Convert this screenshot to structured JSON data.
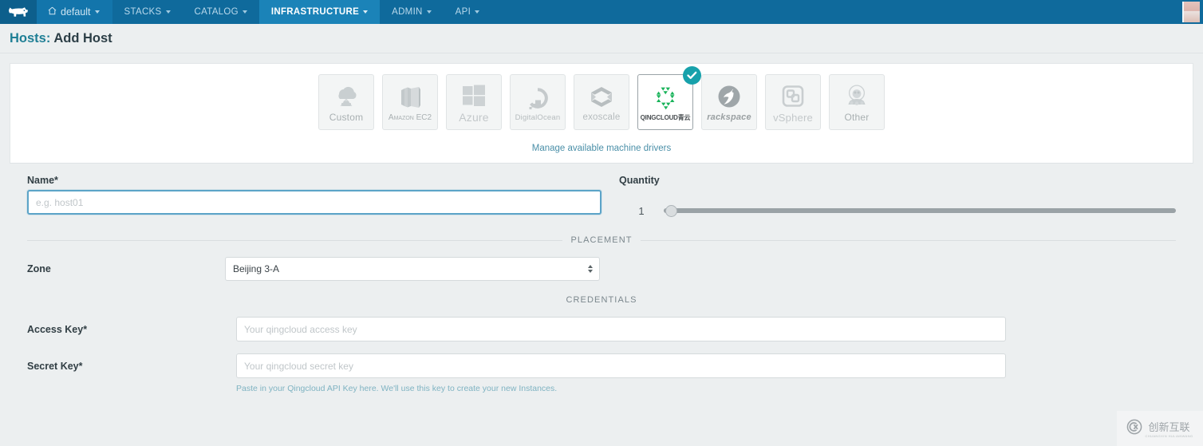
{
  "navbar": {
    "logo_icon": "rancher-cow-logo",
    "home_icon": "home-icon",
    "environment": "default",
    "items": [
      {
        "label": "STACKS",
        "active": false
      },
      {
        "label": "CATALOG",
        "active": false
      },
      {
        "label": "INFRASTRUCTURE",
        "active": true
      },
      {
        "label": "ADMIN",
        "active": false
      },
      {
        "label": "API",
        "active": false
      }
    ]
  },
  "page": {
    "breadcrumb": "Hosts:",
    "title": "Add Host"
  },
  "drivers": {
    "items": [
      {
        "label": "Custom",
        "icon": "custom-cloud-icon",
        "selected": false
      },
      {
        "label": "Amazon EC2",
        "icon": "amazon-ec2-icon",
        "selected": false
      },
      {
        "label": "Azure",
        "icon": "azure-windows-icon",
        "selected": false
      },
      {
        "label": "DigitalOcean",
        "icon": "digitalocean-icon",
        "selected": false
      },
      {
        "label": "exoscale",
        "icon": "exoscale-icon",
        "selected": false
      },
      {
        "label": "QINGCLOUD青云",
        "icon": "qingcloud-icon",
        "selected": true
      },
      {
        "label": "rackspace",
        "icon": "rackspace-icon",
        "selected": false
      },
      {
        "label": "vSphere",
        "icon": "vsphere-icon",
        "selected": false
      },
      {
        "label": "Other",
        "icon": "other-globe-icon",
        "selected": false
      }
    ],
    "manage_link": "Manage available machine drivers",
    "selected_badge_icon": "check-icon",
    "accent_selected": "#17a1ab"
  },
  "form": {
    "name": {
      "label": "Name*",
      "value": "",
      "placeholder": "e.g. host01"
    },
    "quantity": {
      "label": "Quantity",
      "value": "1",
      "min": "1",
      "max": "50"
    },
    "placement_divider": "PLACEMENT",
    "zone": {
      "label": "Zone",
      "value": "Beijing 3-A"
    },
    "credentials_divider": "CREDENTIALS",
    "access_key": {
      "label": "Access Key*",
      "value": "",
      "placeholder": "Your qingcloud access key"
    },
    "secret_key": {
      "label": "Secret Key*",
      "value": "",
      "placeholder": "Your qingcloud secret key"
    },
    "help_text": "Paste in your Qingcloud API Key here. We'll use this key to create your new Instances."
  },
  "watermark": {
    "icon": "cx-logo-icon",
    "text": "创新互联",
    "subtext": "CHUANGXIN HULIANWANG"
  },
  "colors": {
    "nav_bg": "#0f6a9c",
    "nav_active": "#1b83b8",
    "page_bg": "#eceff0",
    "link": "#1f7f95",
    "check_green": "#17a1ab"
  }
}
